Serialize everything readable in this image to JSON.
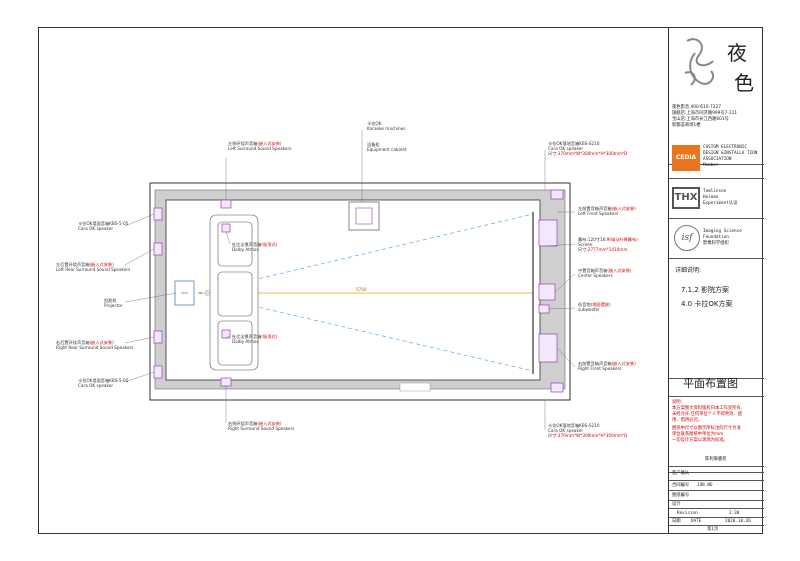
{
  "brand": {
    "chars_top": "夜",
    "chars_bottom": "色",
    "company_line": "夜色影音 400-610-7327",
    "address_1": "旗舰店:上海市同济路999号7-111",
    "address_2": "宝山店:上海市长江西路601号",
    "address_3": "新都荟商场1楼"
  },
  "cedia": {
    "logo": "CEDIA",
    "text_1": "CUSTOM ELECTRONIC",
    "text_2": "DESIGN &INSTALLA TION",
    "text_3": "ASSOCIATION",
    "text_4": "Member"
  },
  "thx": {
    "logo": "THX",
    "text_1": "Tomlinson",
    "text_2": "Holman",
    "text_3": "Experiment认证"
  },
  "isf": {
    "logo": "isf",
    "text_1": "Imaging Science",
    "text_2": "Foundation",
    "text_3": "影像科学组织"
  },
  "details": {
    "heading": "详细说明:",
    "item_1": "7.1.2 影院方案",
    "item_2": "4.0 卡拉OK方案"
  },
  "drawing_title": "平面布置图",
  "notes": {
    "heading": "说明:",
    "line_1": "本方案图文资料版权归本工作室所有,",
    "line_2": "未经允许,任何单位个人不得更改、使",
    "line_3": "用、借用必究。",
    "line_4": "图纸中尺寸以图示所标注的尺寸为准",
    "line_5": "单位联系图纸中单位为mm",
    "line_6": "一切设计方案以现场为标准。"
  },
  "project_name": "陈利御睿苑",
  "client_label": "客户确认",
  "meta": {
    "contract_label": "合同编号",
    "contract_value": "JOB.NO",
    "r2_label": "图纸编号",
    "r3_label": "设计",
    "r4_label": "Revision",
    "r4_value": "1:30",
    "date_label": "日期",
    "date_key": "DATE",
    "date_value": "2020.10.26"
  },
  "page": "第1页",
  "labels": {
    "karaoke": "卡拉OK",
    "karaoke_en": "Karaoke machines",
    "cabinet": "设备柜",
    "cabinet_en": "Equipment cabinet",
    "ls_top": "左侧环绕声音箱",
    "ls_top_red": "(嵌入式安装)",
    "ls_top_en": "Left Surround Sound Speakers",
    "ok_tl": "卡拉OK墙面音箱KBS-5-05",
    "ok_tl_en": "Cara OK speaker",
    "lrs": "左后置环绕声音箱",
    "lrs_red": "(嵌入式安装)",
    "lrs_en": "Left Rear Surround Sound Speakers",
    "proj": "投影机",
    "proj_en": "Projector",
    "rrs": "右后置环绕声音箱",
    "rrs_red": "(嵌入式安装)",
    "rrs_en": "Right Rear Surround Sound Speakers",
    "ok_bl": "卡拉OK墙面音箱KBS-5-05",
    "ok_bl_en": "Cara OK speaker",
    "atmos_t": "杜比全景声音箱",
    "atmos_t_red": "(吸顶式)",
    "atmos_t_en": "Dolby Atmos",
    "atmos_b": "杜比全景声音箱",
    "atmos_b_red": "(吸顶式)",
    "atmos_b_en": "Dolby Atmos",
    "rs_bottom": "右侧环绕声音箱",
    "rs_bottom_red": "(嵌入式安装)",
    "rs_bottom_en": "Right Surround Sound Speakers",
    "ok_tr": "卡拉OK落地音箱KBS-S210",
    "ok_tr_en": "Cara OK speaker",
    "ok_tr_size_k": "尺寸:",
    "ok_tr_size": "370mm*W*300mm*H*300mm*D",
    "lf": "左前置音箱声音箱",
    "lf_red": "(嵌入式安装)",
    "lf_en": "Left Front Speakers",
    "screen": "幕布:120寸16:9",
    "screen_red": "(电动升降幕布)",
    "screen_en": "Screen",
    "screen_size_k": "尺寸:",
    "screen_size": "2777mm*1410mm",
    "center": "中置音箱声音箱",
    "center_red": "(嵌入式安装)",
    "center_en": "Center Speakers",
    "sub": "低音炮",
    "sub_red": "(地面摆放)",
    "sub_en": "subwoofer",
    "rf": "右前置音箱声音箱",
    "rf_red": "(嵌入式安装)",
    "rf_en": "Right Front Speakers",
    "ok_br": "卡拉OK落地音箱KBS-S210",
    "ok_br_en": "Cara OK speaker",
    "ok_br_size_k": "尺寸:",
    "ok_br_size": "370mm*W*300mm*H*300mm*D",
    "dim": "5700"
  },
  "colors": {
    "wall": "#333333",
    "speaker": "#9b3fb5",
    "dashed_ray": "#5aa9e6",
    "dim_line": "#e8a020",
    "note_red": "#d00000",
    "cedia_orange": "#e8761e"
  }
}
